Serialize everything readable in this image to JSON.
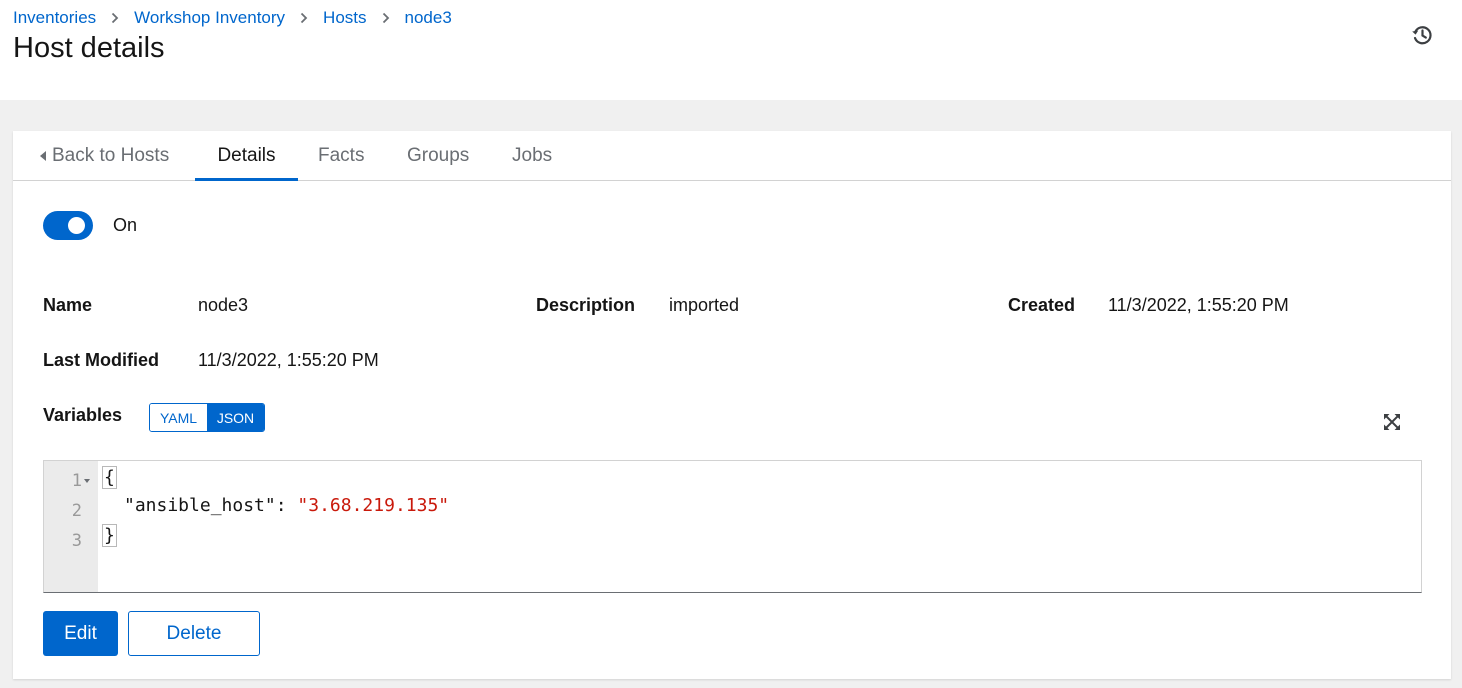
{
  "breadcrumb": [
    {
      "label": "Inventories"
    },
    {
      "label": "Workshop Inventory"
    },
    {
      "label": "Hosts"
    },
    {
      "label": "node3"
    }
  ],
  "page_title": "Host details",
  "icons": {
    "history": "history-icon",
    "expand": "expand-icon",
    "back": "caret-left-icon",
    "separator": "chevron-right-icon"
  },
  "tabs": {
    "back": "Back to Hosts",
    "details": "Details",
    "facts": "Facts",
    "groups": "Groups",
    "jobs": "Jobs",
    "active": "Details"
  },
  "toggle": {
    "label": "On",
    "enabled": true
  },
  "details": {
    "name_label": "Name",
    "name_value": "node3",
    "description_label": "Description",
    "description_value": "imported",
    "created_label": "Created",
    "created_value": "11/3/2022, 1:55:20 PM",
    "modified_label": "Last Modified",
    "modified_value": "11/3/2022, 1:55:20 PM"
  },
  "variables": {
    "label": "Variables",
    "yaml": "YAML",
    "json": "JSON",
    "selected": "JSON",
    "lines": [
      {
        "no": "1",
        "open": "{"
      },
      {
        "no": "2",
        "key": "\"ansible_host\"",
        "colon": ": ",
        "value": "\"3.68.219.135\""
      },
      {
        "no": "3",
        "close": "}"
      }
    ]
  },
  "actions": {
    "edit": "Edit",
    "delete": "Delete"
  },
  "colors": {
    "primary": "#0066cc",
    "string": "#c9190b",
    "background": "#f0f0f0"
  }
}
